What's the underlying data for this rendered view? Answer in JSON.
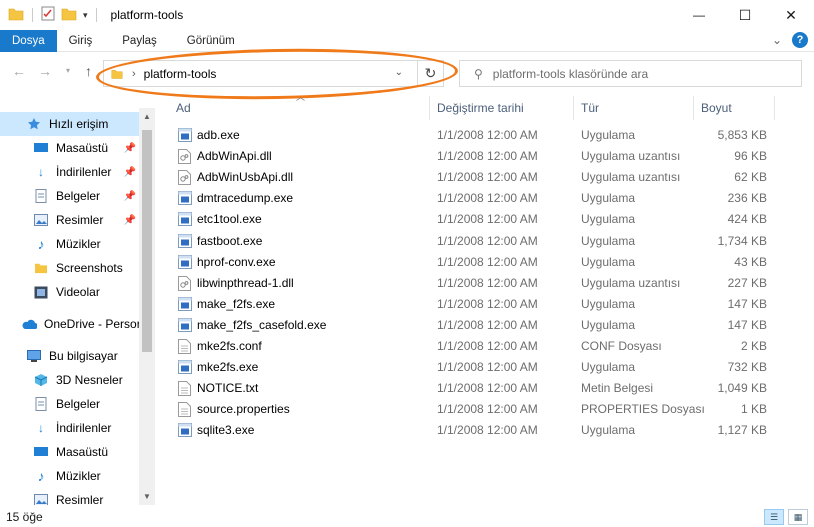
{
  "window": {
    "title": "platform-tools",
    "controls": {
      "minimize": "—",
      "maximize": "☐",
      "close": "✕"
    }
  },
  "ribbon": {
    "tabs": [
      "Dosya",
      "Giriş",
      "Paylaş",
      "Görünüm"
    ],
    "expand_glyph": "⌄",
    "help_label": "?"
  },
  "address": {
    "crumb": "platform-tools",
    "search_placeholder": "platform-tools klasöründe ara"
  },
  "sidebar": {
    "items": [
      {
        "label": "Hızlı erişim",
        "icon": "star-icon"
      },
      {
        "label": "Masaüstü",
        "icon": "desktop-icon",
        "pinned": true
      },
      {
        "label": "İndirilenler",
        "icon": "download-icon",
        "pinned": true
      },
      {
        "label": "Belgeler",
        "icon": "documents-icon",
        "pinned": true
      },
      {
        "label": "Resimler",
        "icon": "pictures-icon",
        "pinned": true
      },
      {
        "label": "Müzikler",
        "icon": "music-icon"
      },
      {
        "label": "Screenshots",
        "icon": "folder-icon"
      },
      {
        "label": "Videolar",
        "icon": "videos-icon"
      },
      {
        "label": "OneDrive - Persor",
        "icon": "cloud-icon"
      },
      {
        "label": "Bu bilgisayar",
        "icon": "computer-icon"
      },
      {
        "label": "3D Nesneler",
        "icon": "cube-icon"
      },
      {
        "label": "Belgeler",
        "icon": "documents-icon"
      },
      {
        "label": "İndirilenler",
        "icon": "download-icon"
      },
      {
        "label": "Masaüstü",
        "icon": "desktop-icon"
      },
      {
        "label": "Müzikler",
        "icon": "music-icon"
      },
      {
        "label": "Resimler",
        "icon": "pictures-icon"
      }
    ]
  },
  "columns": {
    "name": "Ad",
    "date": "Değiştirme tarihi",
    "type": "Tür",
    "size": "Boyut"
  },
  "files": [
    {
      "name": "adb.exe",
      "date": "1/1/2008 12:00 AM",
      "type": "Uygulama",
      "size": "5,853 KB",
      "kind": "exe"
    },
    {
      "name": "AdbWinApi.dll",
      "date": "1/1/2008 12:00 AM",
      "type": "Uygulama uzantısı",
      "size": "96 KB",
      "kind": "dll"
    },
    {
      "name": "AdbWinUsbApi.dll",
      "date": "1/1/2008 12:00 AM",
      "type": "Uygulama uzantısı",
      "size": "62 KB",
      "kind": "dll"
    },
    {
      "name": "dmtracedump.exe",
      "date": "1/1/2008 12:00 AM",
      "type": "Uygulama",
      "size": "236 KB",
      "kind": "exe"
    },
    {
      "name": "etc1tool.exe",
      "date": "1/1/2008 12:00 AM",
      "type": "Uygulama",
      "size": "424 KB",
      "kind": "exe"
    },
    {
      "name": "fastboot.exe",
      "date": "1/1/2008 12:00 AM",
      "type": "Uygulama",
      "size": "1,734 KB",
      "kind": "exe"
    },
    {
      "name": "hprof-conv.exe",
      "date": "1/1/2008 12:00 AM",
      "type": "Uygulama",
      "size": "43 KB",
      "kind": "exe"
    },
    {
      "name": "libwinpthread-1.dll",
      "date": "1/1/2008 12:00 AM",
      "type": "Uygulama uzantısı",
      "size": "227 KB",
      "kind": "dll"
    },
    {
      "name": "make_f2fs.exe",
      "date": "1/1/2008 12:00 AM",
      "type": "Uygulama",
      "size": "147 KB",
      "kind": "exe"
    },
    {
      "name": "make_f2fs_casefold.exe",
      "date": "1/1/2008 12:00 AM",
      "type": "Uygulama",
      "size": "147 KB",
      "kind": "exe"
    },
    {
      "name": "mke2fs.conf",
      "date": "1/1/2008 12:00 AM",
      "type": "CONF Dosyası",
      "size": "2 KB",
      "kind": "txt"
    },
    {
      "name": "mke2fs.exe",
      "date": "1/1/2008 12:00 AM",
      "type": "Uygulama",
      "size": "732 KB",
      "kind": "exe"
    },
    {
      "name": "NOTICE.txt",
      "date": "1/1/2008 12:00 AM",
      "type": "Metin Belgesi",
      "size": "1,049 KB",
      "kind": "txt"
    },
    {
      "name": "source.properties",
      "date": "1/1/2008 12:00 AM",
      "type": "PROPERTIES Dosyası",
      "size": "1 KB",
      "kind": "txt"
    },
    {
      "name": "sqlite3.exe",
      "date": "1/1/2008 12:00 AM",
      "type": "Uygulama",
      "size": "1,127 KB",
      "kind": "exe"
    }
  ],
  "status": {
    "count": "15 öğe"
  },
  "colors": {
    "accent": "#1979ca",
    "selection": "#cce8ff",
    "annotation": "#f07a1a"
  }
}
